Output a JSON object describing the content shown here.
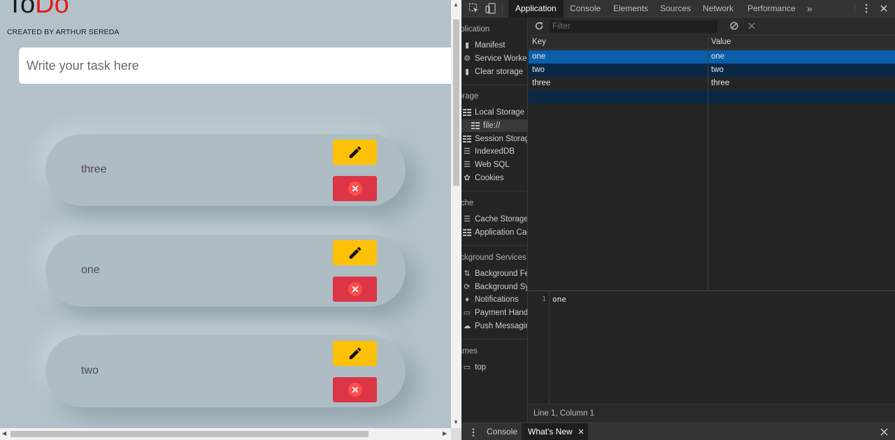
{
  "app": {
    "title_part1": "To",
    "title_part2": "Do",
    "subtitle": "CREATED BY ARTHUR SEREDA",
    "input_placeholder": "Write your task here",
    "tasks": [
      {
        "text": "three"
      },
      {
        "text": "one"
      },
      {
        "text": "two"
      }
    ],
    "colors": {
      "background": "#b3c2ca",
      "edit_button": "#fec107",
      "delete_button": "#dc3545",
      "title_accent": "#e31b1b"
    }
  },
  "devtools": {
    "tabs": [
      "Application",
      "Console",
      "Elements",
      "Sources",
      "Network",
      "Performance"
    ],
    "active_tab": "Application",
    "more_tabs_glyph": "»",
    "sidebar": {
      "application_header": "Application",
      "application_items": [
        "Manifest",
        "Service Workers",
        "Clear storage"
      ],
      "storage_header": "Storage",
      "storage_items": [
        "Local Storage",
        "file://",
        "Session Storage",
        "IndexedDB",
        "Web SQL",
        "Cookies"
      ],
      "cache_header": "Cache",
      "cache_items": [
        "Cache Storage",
        "Application Cache"
      ],
      "background_header": "Background Services",
      "background_items": [
        "Background Fetch",
        "Background Sync",
        "Notifications",
        "Payment Handler",
        "Push Messaging"
      ],
      "frames_header": "Frames",
      "frames_items": [
        "top"
      ]
    },
    "filter_placeholder": "Filter",
    "table": {
      "columns": [
        "Key",
        "Value"
      ],
      "rows": [
        {
          "key": "one",
          "value": "one"
        },
        {
          "key": "two",
          "value": "two"
        },
        {
          "key": "three",
          "value": "three"
        }
      ],
      "selected_row": 0
    },
    "preview": {
      "line_number": "1",
      "content": "one"
    },
    "status": "Line 1, Column 1",
    "drawer_tabs": [
      "Console",
      "What's New"
    ],
    "drawer_active": "What's New",
    "colors": {
      "selected_row": "#0b5ea8",
      "row_focus_bg": "#0b2746",
      "panel_bg": "#242424"
    }
  }
}
